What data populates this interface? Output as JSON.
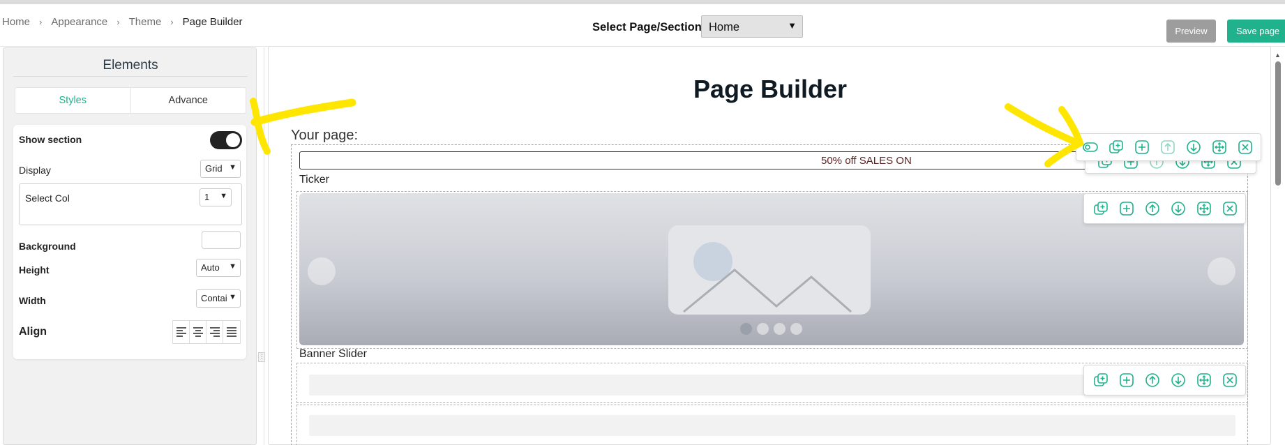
{
  "breadcrumb": {
    "items": [
      "Home",
      "Appearance",
      "Theme"
    ],
    "current": "Page Builder",
    "separator": "›"
  },
  "page_select": {
    "label": "Select Page/Section:",
    "value": "Home"
  },
  "actions": {
    "preview_label": "Preview",
    "save_label": "Save page"
  },
  "left_panel": {
    "title": "Elements",
    "tabs": [
      "Styles",
      "Advance"
    ],
    "active_tab": "Styles",
    "show_section_label": "Show section",
    "show_section_on": true,
    "display_label": "Display",
    "display_value": "Grid",
    "select_col_label": "Select Col",
    "select_col_value": "1",
    "background_label": "Background",
    "height_label": "Height",
    "height_value": "Auto",
    "width_label": "Width",
    "width_value": "Contai",
    "align_label": "Align",
    "align_options": [
      "align-left-icon",
      "align-center-icon",
      "align-right-icon",
      "align-justify-icon"
    ]
  },
  "canvas": {
    "title": "Page Builder",
    "your_page_label": "Your page:",
    "ticker_text": "50% off SALES ON",
    "ticker_label": "Ticker",
    "banner_label": "Banner Slider",
    "banner_slide_count": 4,
    "banner_active_slide": 1
  },
  "section_toolbar_icons": [
    "duplicate-icon",
    "add-icon",
    "move-up-icon",
    "move-down-icon",
    "drag-move-icon",
    "delete-icon"
  ],
  "top_toolbar_icons": [
    "visibility-toggle-icon",
    "duplicate-icon",
    "add-icon",
    "move-up-icon",
    "move-down-icon",
    "drag-move-icon",
    "delete-icon"
  ],
  "colors": {
    "accent": "#1fb28c",
    "preview_button": "#9d9d9d",
    "highlight": "#ffe600",
    "ticker_text": "#5b2222"
  }
}
